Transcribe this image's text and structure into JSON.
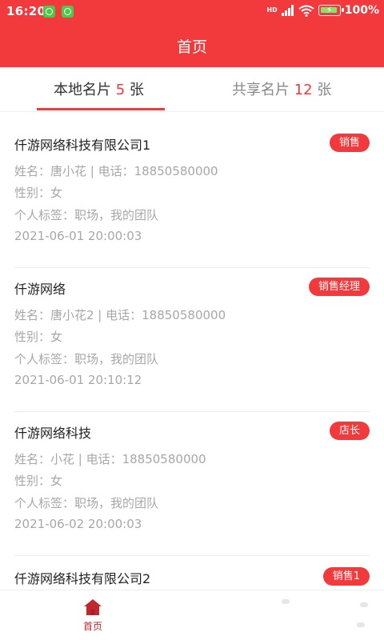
{
  "status_bar": {
    "time": "16:20",
    "network": "HD",
    "battery": "100%"
  },
  "header": {
    "title": "首页"
  },
  "tabs": [
    {
      "label": "本地名片",
      "count": "5",
      "unit": "张",
      "active": true
    },
    {
      "label": "共享名片",
      "count": "12",
      "unit": "张",
      "active": false
    }
  ],
  "cards": [
    {
      "company": "仟游网络科技有限公司1",
      "tag": "销售",
      "name_phone": "姓名：唐小花 | 电话：18850580000",
      "gender": "性别：女",
      "labels": "个人标签：职场，我的团队",
      "time": "2021-06-01 20:00:03"
    },
    {
      "company": "仟游网络",
      "tag": "销售经理",
      "name_phone": "姓名：唐小花2 | 电话：18850580000",
      "gender": "性别：女",
      "labels": "个人标签：职场，我的团队",
      "time": "2021-06-01 20:10:12"
    },
    {
      "company": "仟游网络科技",
      "tag": "店长",
      "name_phone": "姓名：小花 | 电话：18850580000",
      "gender": "性别：女",
      "labels": "个人标签：职场，我的团队",
      "time": "2021-06-02 20:00:03"
    },
    {
      "company": "仟游网络科技有限公司2",
      "tag": "销售1"
    }
  ],
  "bottom_nav": {
    "items": [
      {
        "label": "首页",
        "icon": "home-icon",
        "active": true
      }
    ]
  },
  "colors": {
    "accent": "#f2393c",
    "muted_text": "#a7a7a7",
    "nav_active": "#c0282d"
  }
}
